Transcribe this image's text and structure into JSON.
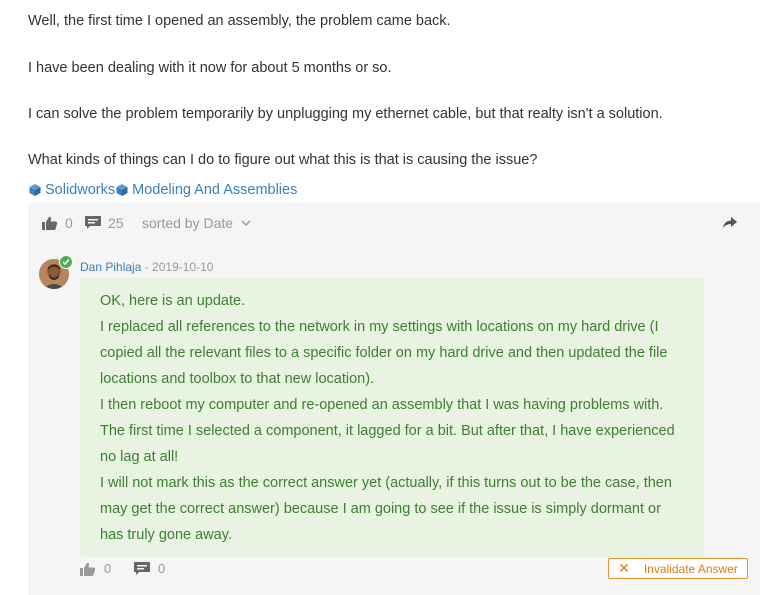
{
  "paragraphs": [
    "Well, the first time I opened an assembly, the problem came back.",
    "I have been dealing with it now for about 5 months or so.",
    "I can solve the problem temporarily by unplugging my ethernet cable, but that realty isn't a solution.",
    "What kinds of things can I do to figure out what this is that is causing the issue?"
  ],
  "tags": [
    "Solidworks",
    "Modeling And Assemblies"
  ],
  "thread_bar": {
    "likes": "0",
    "comments": "25",
    "sort_label": "sorted by Date"
  },
  "answer": {
    "author": "Dan Pihlaja",
    "date": "- 2019-10-10",
    "lines": [
      "OK, here is an update.",
      "I replaced all references to the network in my settings with locations on my hard drive (I",
      "copied all the relevant files to a specific folder on my hard drive and then updated the file",
      "locations and toolbox to that new location).",
      "I then reboot my computer and re-opened an assembly that I was having problems with.",
      "The first time I selected a component, it lagged for a bit.  But after that, I have experienced",
      "no lag at all!",
      "I will not mark this as the correct answer yet (actually, if this turns out to be the case, then",
      "may get the correct answer) because I am going to see if the issue is simply dormant or",
      "has truly gone away."
    ],
    "likes": "0",
    "comments": "0",
    "invalidate_label": "Invalidate Answer"
  },
  "colors": {
    "link": "#3a7fbf",
    "answer_bg": "#e8f3e1",
    "answer_text": "#3e7f31",
    "invalidate": "#e07b16"
  },
  "icons": [
    "cube-icon",
    "thumbs-up-icon",
    "comment-icon",
    "chevron-down-icon",
    "share-icon",
    "verified-check-icon",
    "close-icon"
  ]
}
